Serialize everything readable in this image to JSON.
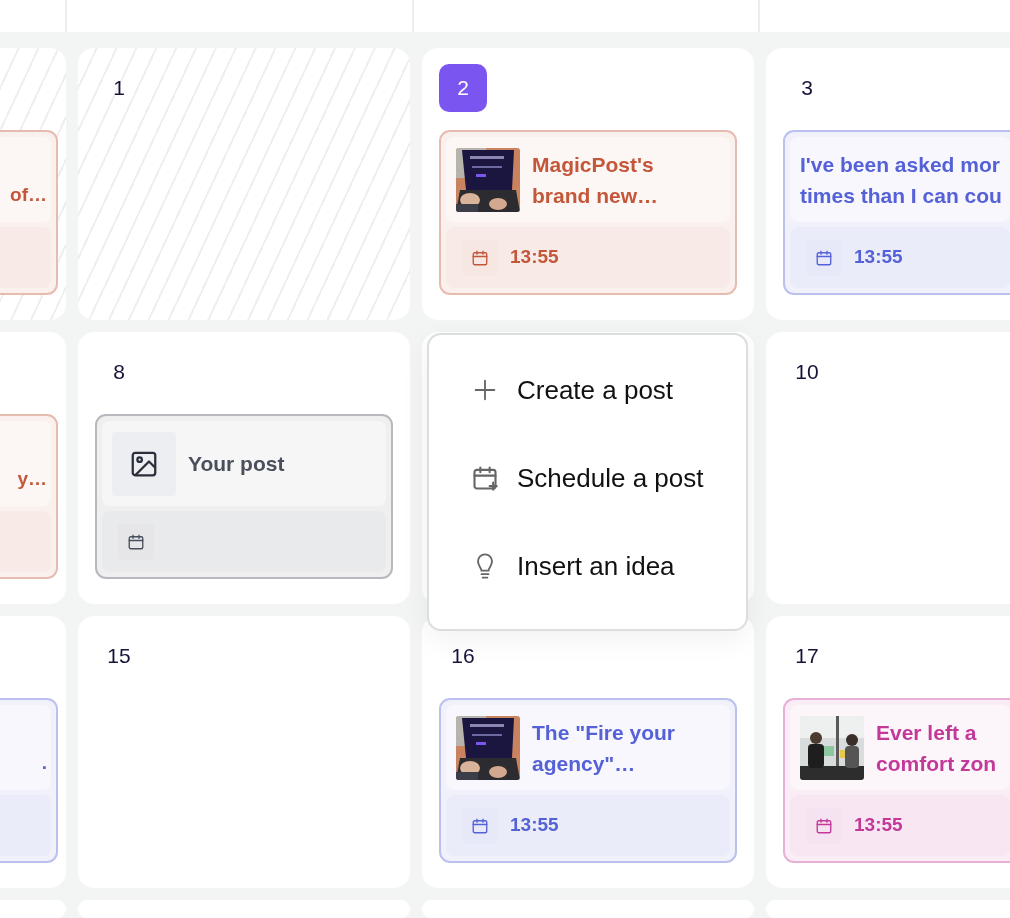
{
  "weeks": [
    {
      "days": [
        {
          "hatched": true,
          "posts": [
            {
              "kind": "clipped",
              "color": "#c4573a",
              "lines": [
                "of…"
              ]
            }
          ]
        },
        {
          "day": "1",
          "hatched": true,
          "today": false
        },
        {
          "day": "2",
          "hatched": false,
          "today": true,
          "posts": [
            {
              "kind": "post",
              "thumb": {
                "kind": "picture"
              },
              "color": "#c4573a",
              "lines": [
                "MagicPost's",
                "brand new…"
              ],
              "time": "13:55"
            }
          ]
        },
        {
          "day": "3",
          "hatched": false,
          "today": false,
          "posts": [
            {
              "kind": "post",
              "color": "#5561d6",
              "lines": [
                "I've been asked mor",
                "times than I can cou"
              ],
              "time": "13:55"
            }
          ]
        }
      ]
    },
    {
      "days": [
        {
          "hatched": false,
          "posts": [
            {
              "kind": "clipped",
              "color": "#c4573a",
              "lines": [
                "y…"
              ]
            }
          ]
        },
        {
          "day": "8",
          "hatched": false,
          "today": false,
          "posts": [
            {
              "kind": "post",
              "thumb": {
                "kind": "placeholder"
              },
              "color": "#4a4f5c",
              "lines": [
                "Your post"
              ]
            }
          ]
        },
        {
          "hatched": false,
          "menu_open": true
        },
        {
          "day": "10",
          "hatched": false,
          "today": false
        }
      ]
    },
    {
      "days": [
        {
          "hatched": false,
          "posts": [
            {
              "kind": "clipped",
              "color": "#5561d6",
              "lines": [
                "."
              ]
            }
          ]
        },
        {
          "day": "15",
          "hatched": false,
          "today": false
        },
        {
          "day": "16",
          "hatched": false,
          "today": false,
          "posts": [
            {
              "kind": "post",
              "thumb": {
                "kind": "picture"
              },
              "color": "#5561d6",
              "lines": [
                "The \"Fire your",
                "agency\"…"
              ],
              "time": "13:55"
            }
          ]
        },
        {
          "day": "17",
          "hatched": false,
          "today": false,
          "posts": [
            {
              "kind": "post",
              "thumb": {
                "kind": "picture"
              },
              "color": "#c2399a",
              "lines": [
                "Ever left a",
                "comfort zon"
              ],
              "time": "13:55"
            }
          ]
        }
      ]
    },
    {
      "days": [
        {
          "hatched": false
        },
        {
          "hatched": false
        },
        {
          "hatched": false
        },
        {
          "hatched": false
        }
      ]
    }
  ],
  "context_menu": {
    "items": [
      {
        "kind": "plus",
        "label": "Create a post"
      },
      {
        "kind": "calendar-plus",
        "label": "Schedule a post"
      },
      {
        "kind": "bulb",
        "label": "Insert an idea"
      }
    ]
  }
}
